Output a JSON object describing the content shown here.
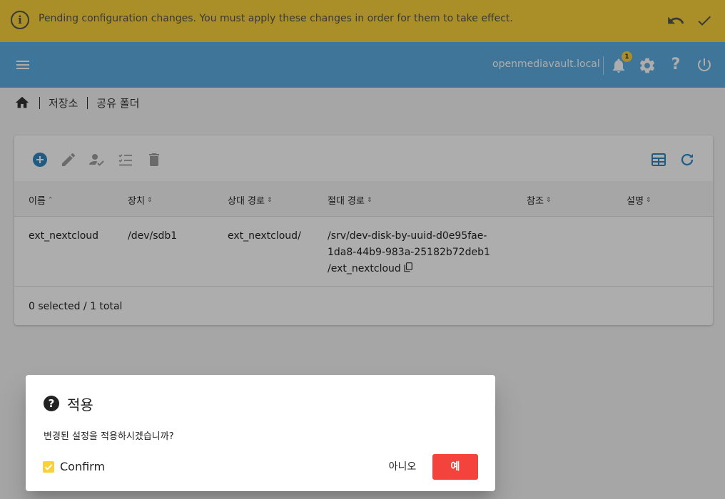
{
  "banner": {
    "message": "Pending configuration changes. You must apply these changes in order for them to take effect.",
    "info_icon_glyph": "i",
    "undo_icon": "undo-icon",
    "apply_icon": "check-icon"
  },
  "topbar": {
    "hostname": "openmediavault.local",
    "notification_count": "1",
    "help_glyph": "?"
  },
  "breadcrumb": {
    "items": [
      "저장소",
      "공유 폴더"
    ]
  },
  "table": {
    "columns": [
      {
        "label": "이름",
        "sort": "⌃"
      },
      {
        "label": "장치",
        "sort": "⇕"
      },
      {
        "label": "상대 경로",
        "sort": "⇕"
      },
      {
        "label": "절대 경로",
        "sort": "⇕"
      },
      {
        "label": "참조",
        "sort": "⇕"
      },
      {
        "label": "설명",
        "sort": "⇕"
      }
    ],
    "rows": [
      {
        "name": "ext_nextcloud",
        "device": "/dev/sdb1",
        "relpath": "ext_nextcloud/",
        "abspath_line1": "/srv/dev-disk-by-uuid-d0e95fae-",
        "abspath_line2": "1da8-44b9-983a-25182b72deb1",
        "abspath_line3": "/ext_nextcloud",
        "refs": "",
        "comment": ""
      }
    ],
    "footer": "0 selected / 1 total"
  },
  "dialog": {
    "title": "적용",
    "question_glyph": "?",
    "message": "변경된 설정을 적용하시겠습니까?",
    "confirm_label": "Confirm",
    "confirm_checked": true,
    "no_label": "아니오",
    "yes_label": "예"
  },
  "colors": {
    "banner": "#fbd13a",
    "topbar": "#5dade2",
    "accent": "#2e86c1",
    "yes_button": "#f4423c"
  }
}
